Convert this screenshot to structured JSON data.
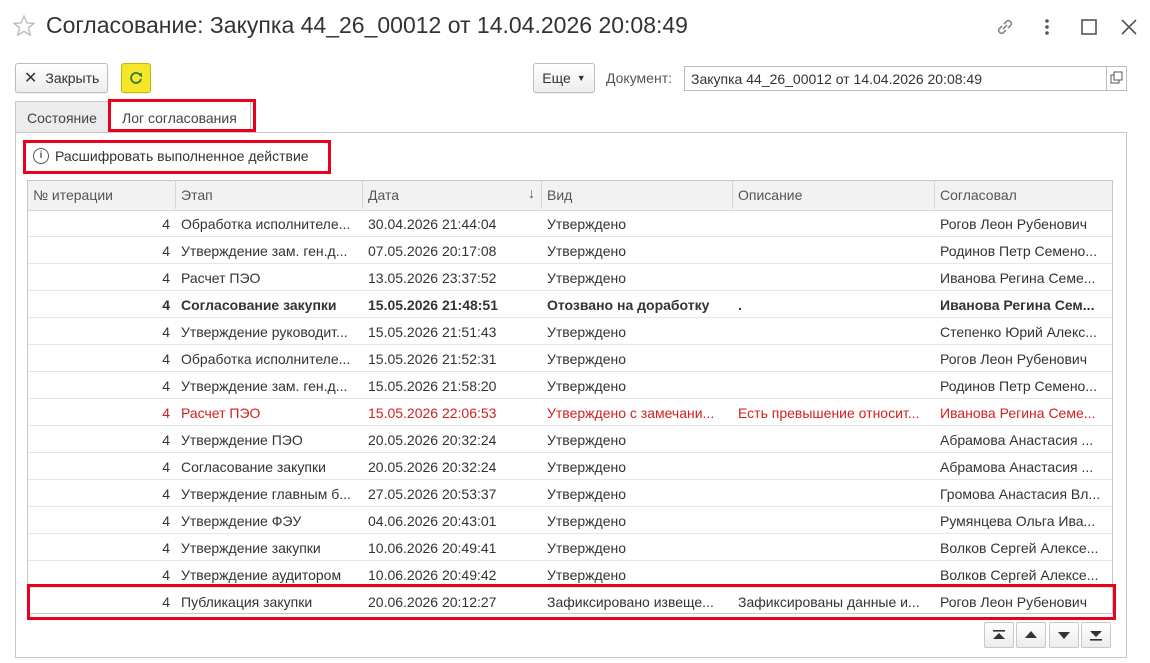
{
  "window": {
    "title": "Согласование: Закупка 44_26_00012 от 14.04.2026 20:08:49",
    "icons": [
      "star-icon",
      "link-icon",
      "more-vert-icon",
      "maximize-icon",
      "close-icon"
    ]
  },
  "toolbar": {
    "close_label": "Закрыть",
    "more_label": "Еще",
    "document_label": "Документ:",
    "document_value": "Закупка 44_26_00012 от 14.04.2026 20:08:49",
    "refresh_color": "#f5e62a"
  },
  "tabs": [
    {
      "label": "Состояние",
      "active": false
    },
    {
      "label": "Лог согласования",
      "active": true
    }
  ],
  "decode_label": "Расшифровать выполненное действие",
  "table": {
    "columns": [
      "№ итерации",
      "Этап",
      "Дата",
      "Вид",
      "Описание",
      "Согласовал"
    ],
    "sorted_column": "Дата",
    "rows": [
      {
        "iter": "4",
        "stage": "Обработка исполнителе...",
        "date": "30.04.2026 21:44:04",
        "kind": "Утверждено",
        "desc": "",
        "approver": "Рогов Леон Рубенович",
        "style": "normal"
      },
      {
        "iter": "4",
        "stage": "Утверждение зам. ген.д...",
        "date": "07.05.2026 20:17:08",
        "kind": "Утверждено",
        "desc": "",
        "approver": "Родинов Петр Семено...",
        "style": "normal"
      },
      {
        "iter": "4",
        "stage": "Расчет ПЭО",
        "date": "13.05.2026 23:37:52",
        "kind": "Утверждено",
        "desc": "",
        "approver": "Иванова Регина Семе...",
        "style": "normal"
      },
      {
        "iter": "4",
        "stage": "Согласование закупки",
        "date": "15.05.2026 21:48:51",
        "kind": "Отозвано на доработку",
        "desc": ".",
        "approver": "Иванова Регина Сем...",
        "style": "bold"
      },
      {
        "iter": "4",
        "stage": "Утверждение руководит...",
        "date": "15.05.2026 21:51:43",
        "kind": "Утверждено",
        "desc": "",
        "approver": "Степенко Юрий Алекс...",
        "style": "normal"
      },
      {
        "iter": "4",
        "stage": "Обработка исполнителе...",
        "date": "15.05.2026 21:52:31",
        "kind": "Утверждено",
        "desc": "",
        "approver": "Рогов Леон Рубенович",
        "style": "normal"
      },
      {
        "iter": "4",
        "stage": "Утверждение зам. ген.д...",
        "date": "15.05.2026 21:58:20",
        "kind": "Утверждено",
        "desc": "",
        "approver": "Родинов Петр Семено...",
        "style": "normal"
      },
      {
        "iter": "4",
        "stage": "Расчет ПЭО",
        "date": "15.05.2026 22:06:53",
        "kind": "Утверждено с замечани...",
        "desc": "Есть превышение относит...",
        "approver": "Иванова Регина Семе...",
        "style": "red"
      },
      {
        "iter": "4",
        "stage": "Утверждение ПЭО",
        "date": "20.05.2026 20:32:24",
        "kind": "Утверждено",
        "desc": "",
        "approver": "Абрамова Анастасия ...",
        "style": "normal"
      },
      {
        "iter": "4",
        "stage": "Согласование закупки",
        "date": "20.05.2026 20:32:24",
        "kind": "Утверждено",
        "desc": "",
        "approver": "Абрамова Анастасия ...",
        "style": "normal"
      },
      {
        "iter": "4",
        "stage": "Утверждение главным б...",
        "date": "27.05.2026 20:53:37",
        "kind": "Утверждено",
        "desc": "",
        "approver": "Громова Анастасия Вл...",
        "style": "normal"
      },
      {
        "iter": "4",
        "stage": "Утверждение ФЭУ",
        "date": "04.06.2026 20:43:01",
        "kind": "Утверждено",
        "desc": "",
        "approver": "Румянцева Ольга Ива...",
        "style": "normal"
      },
      {
        "iter": "4",
        "stage": "Утверждение закупки",
        "date": "10.06.2026 20:49:41",
        "kind": "Утверждено",
        "desc": "",
        "approver": "Волков Сергей Алексе...",
        "style": "normal"
      },
      {
        "iter": "4",
        "stage": "Утверждение аудитором",
        "date": "10.06.2026 20:49:42",
        "kind": "Утверждено",
        "desc": "",
        "approver": "Волков Сергей Алексе...",
        "style": "normal"
      },
      {
        "iter": "4",
        "stage": "Публикация закупки",
        "date": "20.06.2026 20:12:27",
        "kind": "Зафиксировано извеще...",
        "desc": "Зафиксированы данные и...",
        "approver": "Рогов Леон Рубенович",
        "style": "normal"
      }
    ]
  },
  "nav_buttons": [
    "first-icon",
    "prev-icon",
    "next-icon",
    "last-icon"
  ],
  "colors": {
    "accent_highlight": "#e8001c",
    "error_text": "#d32020"
  }
}
